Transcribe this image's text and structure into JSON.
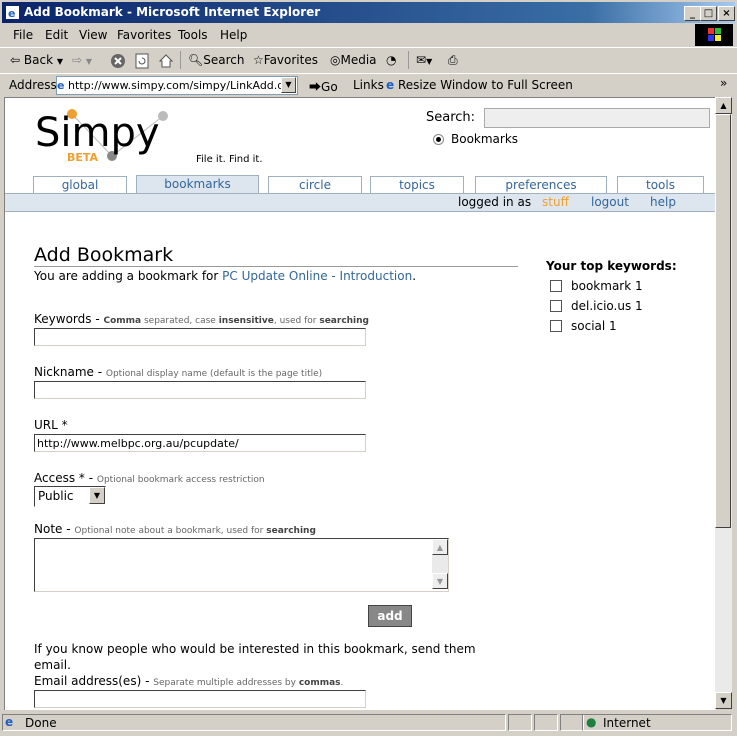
{
  "window": {
    "title": "Add Bookmark - Microsoft Internet Explorer",
    "controls": {
      "minimize": "_",
      "maximize": "□",
      "close": "×"
    }
  },
  "menu": [
    "File",
    "Edit",
    "View",
    "Favorites",
    "Tools",
    "Help"
  ],
  "toolbar": {
    "back": "Back",
    "search": "Search",
    "favorites": "Favorites",
    "media": "Media"
  },
  "address": {
    "label": "Address",
    "url": "http://www.simpy.com/simpy/LinkAdd.do?t",
    "go": "Go",
    "links": "Links",
    "resize": "Resize Window to Full Screen"
  },
  "site": {
    "logo": "Simpy",
    "beta": "BETA",
    "tagline": "File it. Find it.",
    "search_label": "Search:",
    "search_scope": "Bookmarks",
    "tabs": [
      "global",
      "bookmarks",
      "circle",
      "topics",
      "preferences",
      "tools"
    ],
    "active_tab": "bookmarks",
    "user_bar": {
      "logged_in_as": "logged in as",
      "username": "stuff",
      "logout": "logout",
      "help": "help"
    }
  },
  "form": {
    "title": "Add Bookmark",
    "intro_prefix": "You are adding a bookmark for",
    "intro_link": "PC Update Online - Introduction",
    "intro_suffix": ".",
    "keywords": {
      "label": "Keywords -",
      "hint_1": "Comma",
      "hint_2": " separated, case ",
      "hint_3": "insensitive",
      "hint_4": ", used for ",
      "hint_5": "searching",
      "value": ""
    },
    "nickname": {
      "label": "Nickname -",
      "hint": "Optional display name (default is the page title)",
      "value": ""
    },
    "url": {
      "label": "URL *",
      "value": "http://www.melbpc.org.au/pcupdate/"
    },
    "access": {
      "label": "Access * -",
      "hint": "Optional bookmark access restriction",
      "selected": "Public"
    },
    "note": {
      "label": "Note -",
      "hint_1": "Optional note about a bookmark, used for ",
      "hint_2": "searching",
      "value": ""
    },
    "submit": "add",
    "email_intro": "If you know people who would be interested in this bookmark, send them email.",
    "email": {
      "label": "Email address(es) -",
      "hint_1": "Separate multiple addresses by ",
      "hint_2": "commas",
      "hint_3": ".",
      "value": ""
    }
  },
  "keywords_panel": {
    "title": "Your top keywords:",
    "items": [
      {
        "label": "bookmark 1"
      },
      {
        "label": "del.icio.us 1"
      },
      {
        "label": "social 1"
      }
    ]
  },
  "status": {
    "text": "Done",
    "zone": "Internet"
  }
}
